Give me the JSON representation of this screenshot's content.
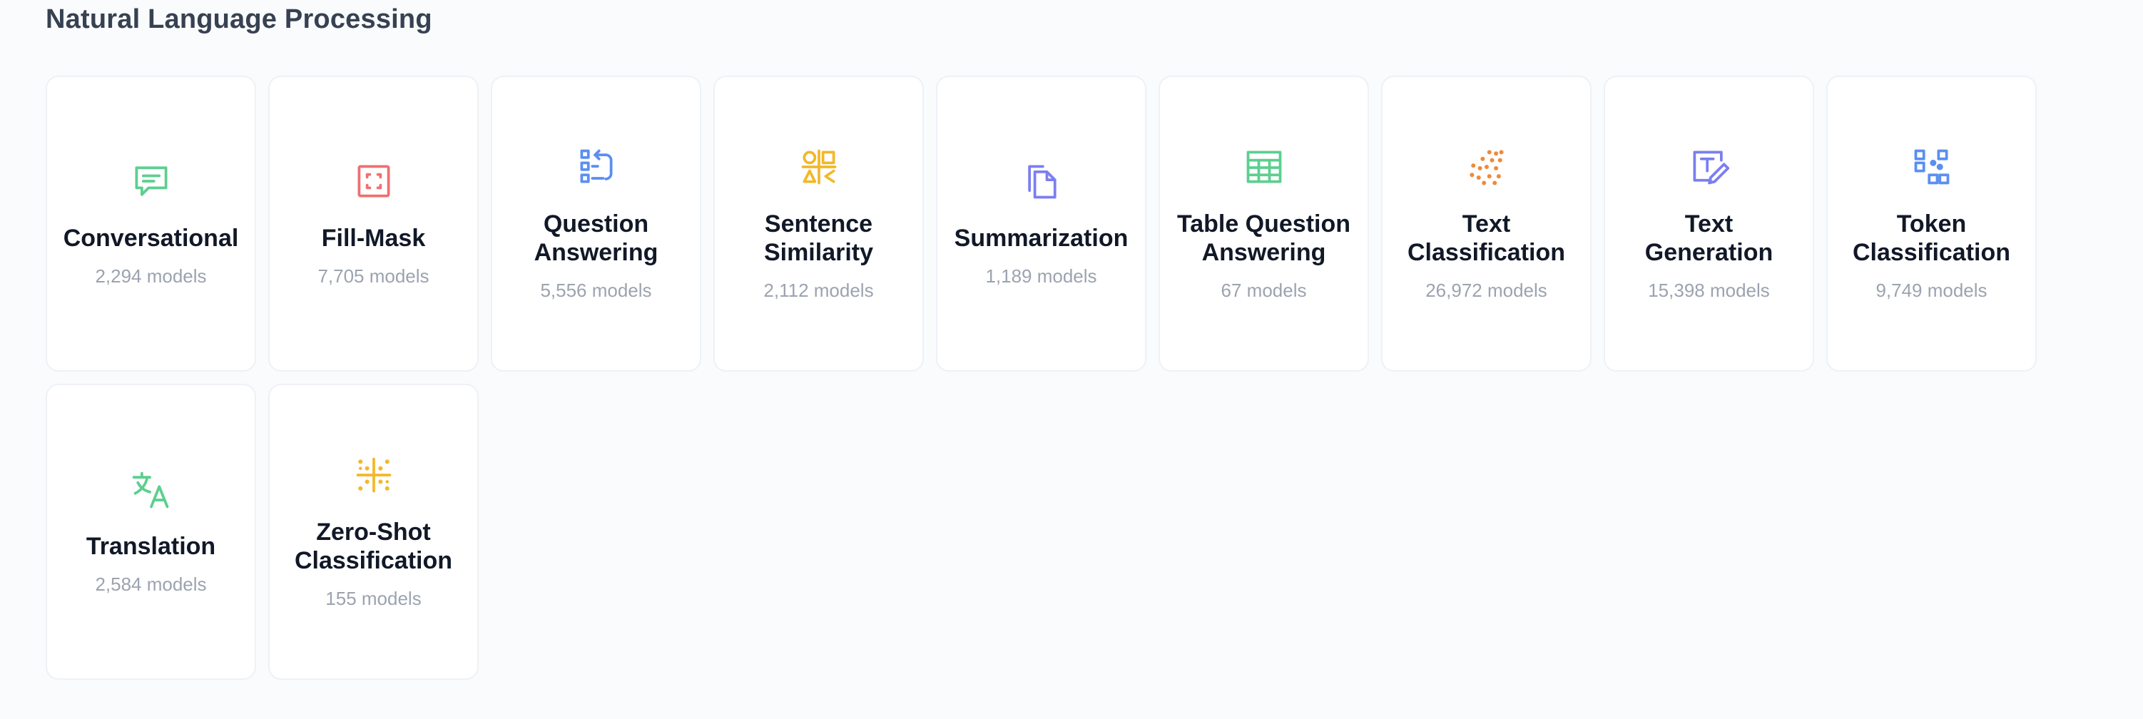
{
  "section": {
    "title": "Natural Language Processing"
  },
  "colors": {
    "green": "#5ccf8f",
    "red": "#ef6f6f",
    "blue": "#5b8ff0",
    "yellow": "#f2b829",
    "indigo": "#7b7ff0",
    "orange": "#ef8a3a"
  },
  "tasks": [
    {
      "label": "Conversational",
      "count": "2,294 models",
      "icon": "chat-bubble-icon"
    },
    {
      "label": "Fill-Mask",
      "count": "7,705 models",
      "icon": "mask-frame-icon"
    },
    {
      "label": "Question Answering",
      "count": "5,556 models",
      "icon": "question-answering-icon"
    },
    {
      "label": "Sentence Similarity",
      "count": "2,112 models",
      "icon": "sentence-similarity-icon"
    },
    {
      "label": "Summarization",
      "count": "1,189 models",
      "icon": "documents-icon"
    },
    {
      "label": "Table Question Answering",
      "count": "67 models",
      "icon": "table-icon"
    },
    {
      "label": "Text Classification",
      "count": "26,972 models",
      "icon": "dots-scatter-icon"
    },
    {
      "label": "Text Generation",
      "count": "15,398 models",
      "icon": "text-edit-icon"
    },
    {
      "label": "Token Classification",
      "count": "9,749 models",
      "icon": "token-blocks-icon"
    },
    {
      "label": "Translation",
      "count": "2,584 models",
      "icon": "translate-icon"
    },
    {
      "label": "Zero-Shot Classification",
      "count": "155 models",
      "icon": "sparkle-grid-icon"
    }
  ]
}
